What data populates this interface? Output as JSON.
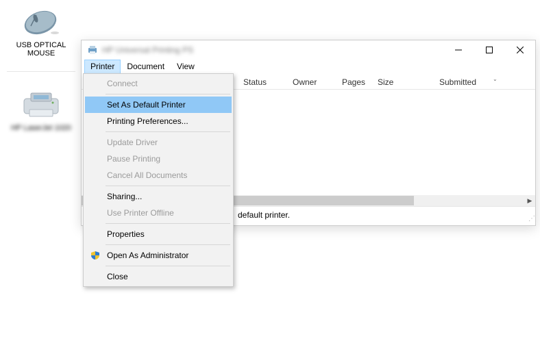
{
  "desktop": {
    "mouse_label": "USB OPTICAL\nMOUSE",
    "printer_label": "HP LaserJet 1020"
  },
  "window": {
    "title": "HP Universal Printing PS",
    "menubar": {
      "printer": "Printer",
      "document": "Document",
      "view": "View"
    },
    "columns": {
      "status": "Status",
      "owner": "Owner",
      "pages": "Pages",
      "size": "Size",
      "submitted": "Submitted"
    },
    "statusbar_fragment": "default printer."
  },
  "dropdown": {
    "connect": "Connect",
    "set_default": "Set As Default Printer",
    "printing_prefs": "Printing Preferences...",
    "update_driver": "Update Driver",
    "pause_printing": "Pause Printing",
    "cancel_all": "Cancel All Documents",
    "sharing": "Sharing...",
    "use_offline": "Use Printer Offline",
    "properties": "Properties",
    "open_admin": "Open As Administrator",
    "close": "Close"
  }
}
